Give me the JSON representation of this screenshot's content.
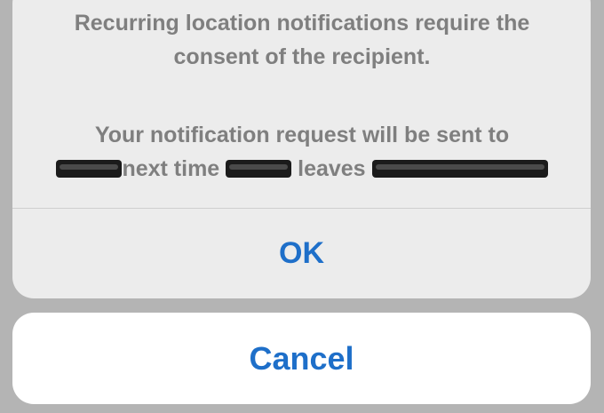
{
  "alert": {
    "message_line1": "Recurring location notifications require the",
    "message_line2": "consent of the recipient.",
    "message2_line1": "Your notification request will be sent to",
    "message2_next_time": "next time",
    "message2_leaves": "leaves",
    "ok_label": "OK"
  },
  "cancel": {
    "label": "Cancel"
  },
  "colors": {
    "accent": "#1e6fc9",
    "text_muted": "#7f7f7f",
    "alert_bg": "#ececec",
    "sheet_bg": "#ffffff",
    "backdrop": "#b4b4b4"
  }
}
